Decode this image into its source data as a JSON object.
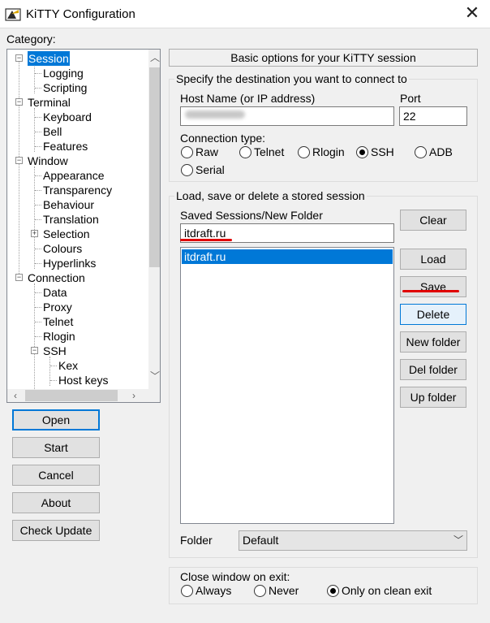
{
  "window": {
    "title": "KiTTY Configuration",
    "close_glyph": "✕",
    "icon": "kitty-app-icon"
  },
  "category": {
    "label": "Category:",
    "tree": [
      {
        "label": "Session",
        "level": 0,
        "expander": "−",
        "selected": true
      },
      {
        "label": "Logging",
        "level": 1
      },
      {
        "label": "Scripting",
        "level": 1
      },
      {
        "label": "Terminal",
        "level": 0,
        "expander": "−"
      },
      {
        "label": "Keyboard",
        "level": 1
      },
      {
        "label": "Bell",
        "level": 1
      },
      {
        "label": "Features",
        "level": 1
      },
      {
        "label": "Window",
        "level": 0,
        "expander": "−"
      },
      {
        "label": "Appearance",
        "level": 1
      },
      {
        "label": "Transparency",
        "level": 1
      },
      {
        "label": "Behaviour",
        "level": 1
      },
      {
        "label": "Translation",
        "level": 1
      },
      {
        "label": "Selection",
        "level": 1,
        "expander": "+"
      },
      {
        "label": "Colours",
        "level": 1
      },
      {
        "label": "Hyperlinks",
        "level": 1
      },
      {
        "label": "Connection",
        "level": 0,
        "expander": "−"
      },
      {
        "label": "Data",
        "level": 1
      },
      {
        "label": "Proxy",
        "level": 1
      },
      {
        "label": "Telnet",
        "level": 1
      },
      {
        "label": "Rlogin",
        "level": 1
      },
      {
        "label": "SSH",
        "level": 1,
        "expander": "−"
      },
      {
        "label": "Kex",
        "level": 2
      },
      {
        "label": "Host keys",
        "level": 2
      }
    ]
  },
  "left_buttons": {
    "open": "Open",
    "start": "Start",
    "cancel": "Cancel",
    "about": "About",
    "check_update": "Check Update"
  },
  "header": {
    "title": "Basic options for your KiTTY session"
  },
  "destination": {
    "group_title": "Specify the destination you want to connect to",
    "host_label": "Host Name (or IP address)",
    "host_value": "",
    "port_label": "Port",
    "port_value": "22",
    "conn_type_label": "Connection type:",
    "conn_types": [
      "Raw",
      "Telnet",
      "Rlogin",
      "SSH",
      "ADB",
      "Serial"
    ],
    "selected_type": "SSH"
  },
  "sessions": {
    "group_title": "Load, save or delete a stored session",
    "saved_label": "Saved Sessions/New Folder",
    "saved_value": "itdraft.ru",
    "list": [
      "itdraft.ru"
    ],
    "buttons": {
      "clear": "Clear",
      "load": "Load",
      "save": "Save",
      "delete": "Delete",
      "new_folder": "New folder",
      "del_folder": "Del folder",
      "up_folder": "Up folder"
    },
    "folder_label": "Folder",
    "folder_value": "Default"
  },
  "close_on_exit": {
    "group_title": "Close window on exit:",
    "options": [
      "Always",
      "Never",
      "Only on clean exit"
    ],
    "selected": "Only on clean exit"
  },
  "colors": {
    "accent": "#0078d7",
    "annotation": "#e00000"
  }
}
